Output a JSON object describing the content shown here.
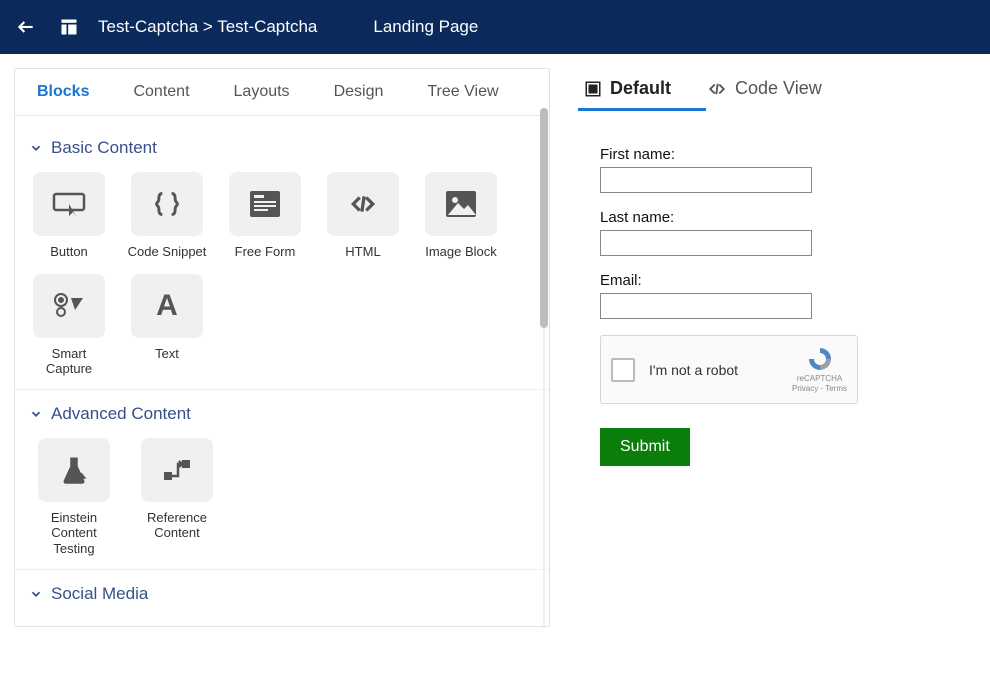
{
  "header": {
    "breadcrumb": "Test-Captcha > Test-Captcha",
    "page_label": "Landing Page"
  },
  "left": {
    "tabs": [
      "Blocks",
      "Content",
      "Layouts",
      "Design",
      "Tree View"
    ],
    "active_tab": "Blocks",
    "sections": {
      "basic": {
        "title": "Basic Content",
        "items": [
          {
            "label": "Button",
            "icon": "button-icon"
          },
          {
            "label": "Code Snippet",
            "icon": "braces-icon"
          },
          {
            "label": "Free Form",
            "icon": "freeform-icon"
          },
          {
            "label": "HTML",
            "icon": "html-icon"
          },
          {
            "label": "Image Block",
            "icon": "image-icon"
          },
          {
            "label": "Smart Capture",
            "icon": "smartcapture-icon"
          },
          {
            "label": "Text",
            "icon": "text-icon"
          }
        ]
      },
      "advanced": {
        "title": "Advanced Content",
        "items": [
          {
            "label": "Einstein Content Testing",
            "icon": "flask-icon"
          },
          {
            "label": "Reference Content",
            "icon": "reference-icon"
          }
        ]
      },
      "social": {
        "title": "Social Media"
      }
    }
  },
  "right": {
    "view_tabs": {
      "default": "Default",
      "code": "Code View"
    },
    "form": {
      "first_name_label": "First name:",
      "last_name_label": "Last name:",
      "email_label": "Email:",
      "first_name_value": "",
      "last_name_value": "",
      "email_value": ""
    },
    "captcha": {
      "text": "I'm not a robot",
      "brand": "reCAPTCHA",
      "legal": "Privacy - Terms"
    },
    "submit_label": "Submit"
  }
}
